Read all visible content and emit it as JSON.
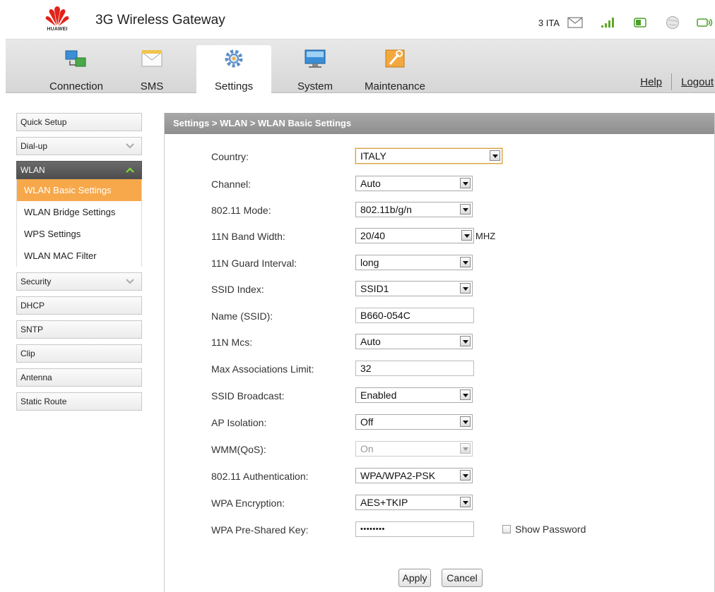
{
  "header": {
    "logo_text": "HUAWEI",
    "title": "3G Wireless Gateway",
    "carrier": "3 ITA",
    "status_icons": [
      "mail-icon",
      "signal-icon",
      "sim-icon",
      "globe-icon",
      "wifi-icon"
    ]
  },
  "nav": {
    "tabs": [
      {
        "label": "Connection",
        "icon": "connection-icon"
      },
      {
        "label": "SMS",
        "icon": "sms-icon"
      },
      {
        "label": "Settings",
        "icon": "settings-icon",
        "active": true
      },
      {
        "label": "System",
        "icon": "system-icon"
      },
      {
        "label": "Maintenance",
        "icon": "maintenance-icon"
      }
    ],
    "help": "Help",
    "logout": "Logout"
  },
  "sidebar": {
    "items": [
      {
        "label": "Quick Setup"
      },
      {
        "label": "Dial-up"
      },
      {
        "label": "WLAN",
        "open": true
      },
      {
        "label": "Security"
      },
      {
        "label": "DHCP"
      },
      {
        "label": "SNTP"
      },
      {
        "label": "Clip"
      },
      {
        "label": "Antenna"
      },
      {
        "label": "Static Route"
      }
    ],
    "wlan_sub": [
      {
        "label": "WLAN Basic Settings",
        "active": true
      },
      {
        "label": "WLAN Bridge Settings"
      },
      {
        "label": "WPS Settings"
      },
      {
        "label": "WLAN MAC Filter"
      }
    ]
  },
  "content": {
    "breadcrumb": "Settings > WLAN > WLAN Basic Settings",
    "fields": {
      "country": {
        "label": "Country:",
        "value": "ITALY"
      },
      "channel": {
        "label": "Channel:",
        "value": "Auto"
      },
      "mode": {
        "label": "802.11 Mode:",
        "value": "802.11b/g/n"
      },
      "bandwidth": {
        "label": "11N Band Width:",
        "value": "20/40",
        "unit": "MHZ"
      },
      "guard": {
        "label": "11N Guard Interval:",
        "value": "long"
      },
      "ssid_index": {
        "label": "SSID Index:",
        "value": "SSID1"
      },
      "ssid_name": {
        "label": "Name (SSID):",
        "value": "B660-054C"
      },
      "mcs": {
        "label": "11N Mcs:",
        "value": "Auto"
      },
      "max_assoc": {
        "label": "Max Associations Limit:",
        "value": "32"
      },
      "ssid_broadcast": {
        "label": "SSID Broadcast:",
        "value": "Enabled"
      },
      "ap_isolation": {
        "label": "AP Isolation:",
        "value": "Off"
      },
      "wmm": {
        "label": "WMM(QoS):",
        "value": "On"
      },
      "auth": {
        "label": "802.11 Authentication:",
        "value": "WPA/WPA2-PSK"
      },
      "encryption": {
        "label": "WPA Encryption:",
        "value": "AES+TKIP"
      },
      "psk": {
        "label": "WPA Pre-Shared Key:",
        "value": "••••••••"
      }
    },
    "show_password": "Show Password",
    "apply": "Apply",
    "cancel": "Cancel"
  },
  "colors": {
    "accent": "#f6a84a",
    "menu_open": "#555555",
    "title_bar": "#9a9a9a",
    "brand_red": "#e2231a"
  }
}
